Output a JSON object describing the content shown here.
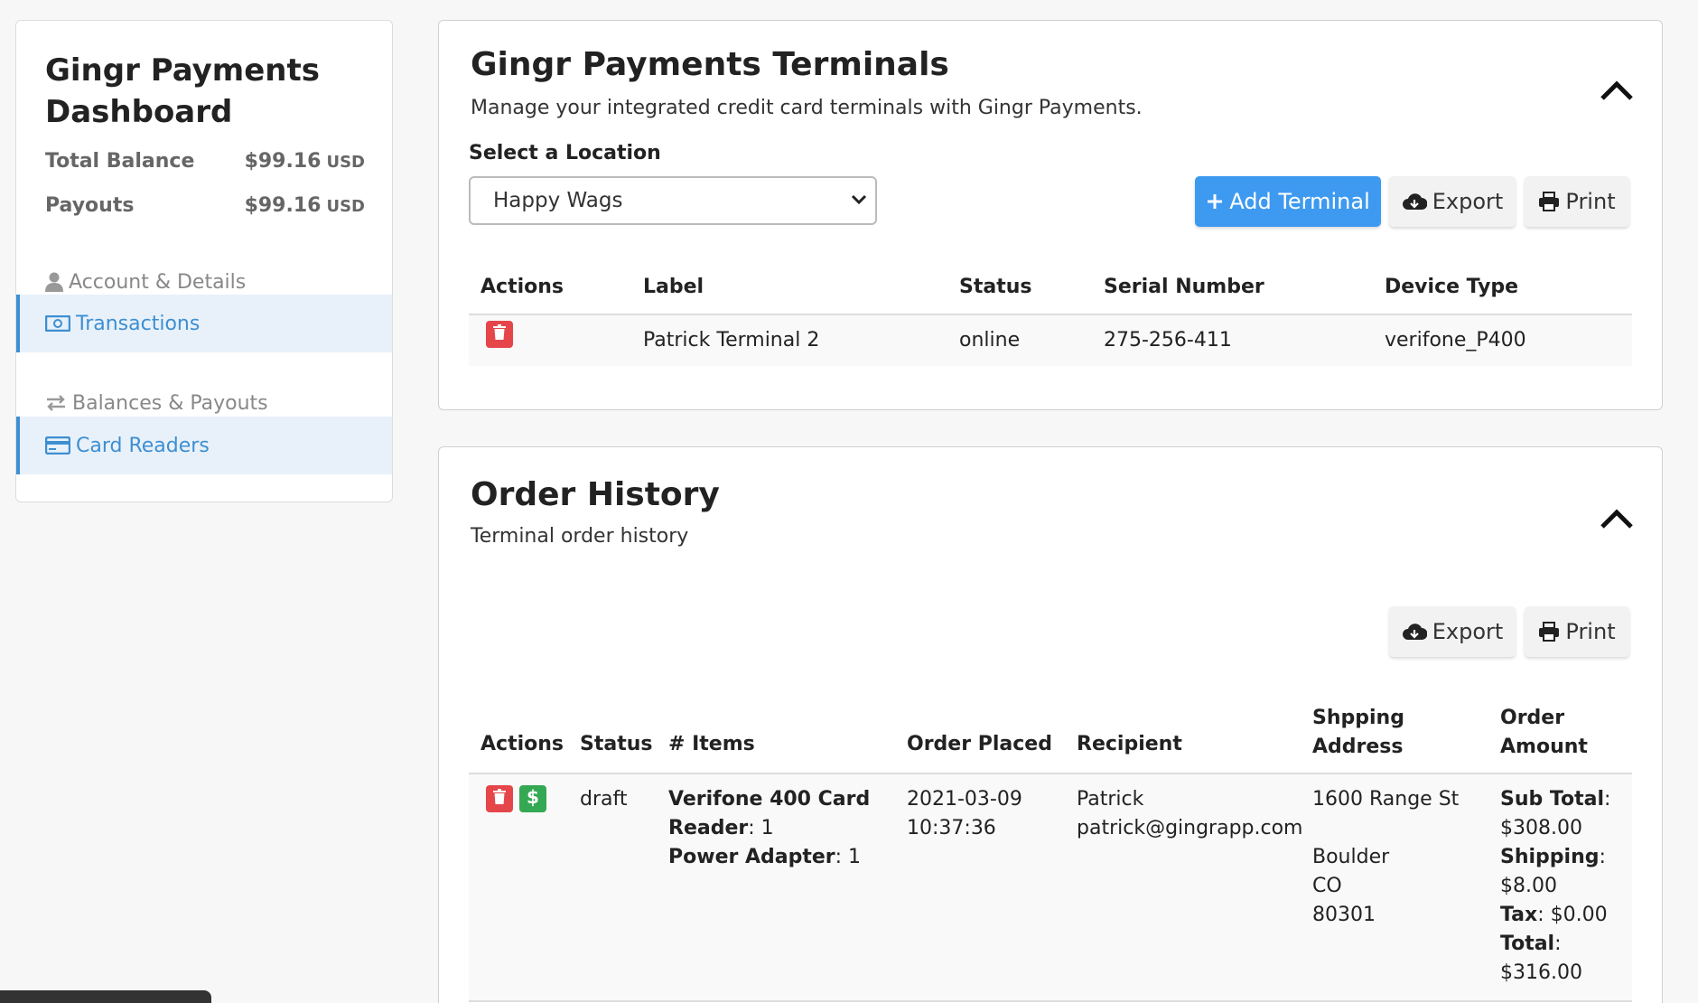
{
  "sidebar": {
    "title_line1": "Gingr Payments",
    "title_line2": "Dashboard",
    "total_balance_label": "Total Balance",
    "total_balance_amount": "$99.16",
    "total_balance_currency": "USD",
    "payouts_label": "Payouts",
    "payouts_amount": "$99.16",
    "payouts_currency": "USD",
    "nav": [
      {
        "label": "Account & Details",
        "icon": "user-icon"
      },
      {
        "label": "Transactions",
        "icon": "money-icon"
      },
      {
        "label": "Balances & Payouts",
        "icon": "exchange-icon"
      },
      {
        "label": "Card Readers",
        "icon": "credit-card-icon"
      }
    ]
  },
  "terminals": {
    "title": "Gingr Payments Terminals",
    "subtitle": "Manage your integrated credit card terminals with Gingr Payments.",
    "location_label": "Select a Location",
    "location_value": "Happy Wags",
    "add_button": "Add Terminal",
    "export_button": "Export",
    "print_button": "Print",
    "columns": [
      "Actions",
      "Label",
      "Status",
      "Serial Number",
      "Device Type"
    ],
    "rows": [
      {
        "label": "Patrick Terminal 2",
        "status": "online",
        "serial": "275-256-411",
        "device": "verifone_P400"
      }
    ]
  },
  "orders": {
    "title": "Order History",
    "subtitle": "Terminal order history",
    "export_button": "Export",
    "print_button": "Print",
    "columns": {
      "actions": "Actions",
      "status": "Status",
      "items": "# Items",
      "placed": "Order Placed",
      "recipient": "Recipient",
      "shipping_l1": "Shpping",
      "shipping_l2": "Address",
      "amount_l1": "Order",
      "amount_l2": "Amount"
    },
    "row": {
      "status": "draft",
      "item1_name_l1": "Verifone 400 Card",
      "item1_name_l2": "Reader",
      "item1_qty": ": 1",
      "item2_name": "Power Adapter",
      "item2_qty": ": 1",
      "date": "2021-03-09",
      "time": "10:37:36",
      "recipient_name": "Patrick",
      "recipient_email": "patrick@gingrapp.com",
      "addr_street": "1600 Range St",
      "addr_city": "Boulder",
      "addr_state": "CO",
      "addr_zip": "80301",
      "subtotal_label": "Sub Total",
      "subtotal_value": "$308.00",
      "shipping_label": "Shipping",
      "shipping_value": "$8.00",
      "tax_label": "Tax",
      "tax_value": ": $0.00",
      "total_label": "Total",
      "total_value": "$316.00"
    }
  },
  "colors": {
    "accent_blue": "#3d9af0",
    "nav_active": "#3d8fd1",
    "delete_red": "#e5464a",
    "pay_green": "#35a853"
  }
}
